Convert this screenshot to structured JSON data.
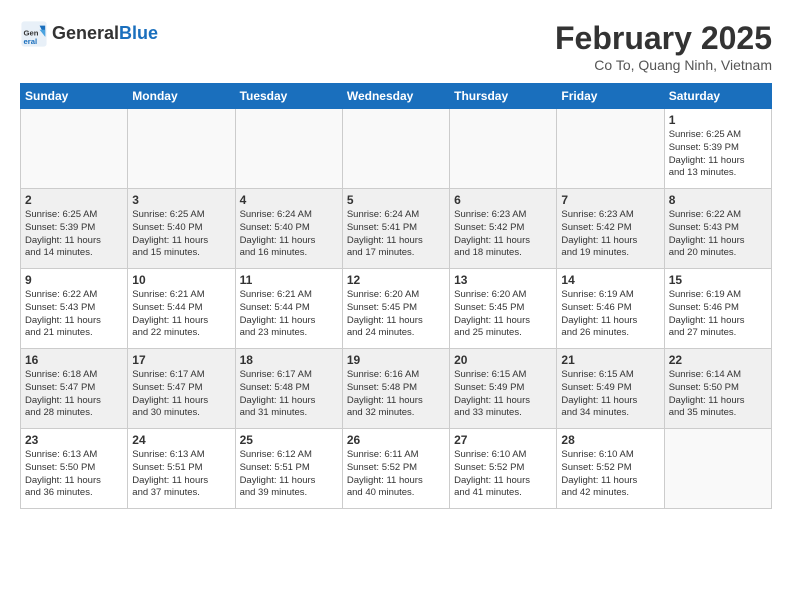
{
  "header": {
    "logo_general": "General",
    "logo_blue": "Blue",
    "title": "February 2025",
    "subtitle": "Co To, Quang Ninh, Vietnam"
  },
  "days_of_week": [
    "Sunday",
    "Monday",
    "Tuesday",
    "Wednesday",
    "Thursday",
    "Friday",
    "Saturday"
  ],
  "weeks": [
    [
      {
        "day": "",
        "info": ""
      },
      {
        "day": "",
        "info": ""
      },
      {
        "day": "",
        "info": ""
      },
      {
        "day": "",
        "info": ""
      },
      {
        "day": "",
        "info": ""
      },
      {
        "day": "",
        "info": ""
      },
      {
        "day": "1",
        "info": "Sunrise: 6:25 AM\nSunset: 5:39 PM\nDaylight: 11 hours\nand 13 minutes."
      }
    ],
    [
      {
        "day": "2",
        "info": "Sunrise: 6:25 AM\nSunset: 5:39 PM\nDaylight: 11 hours\nand 14 minutes."
      },
      {
        "day": "3",
        "info": "Sunrise: 6:25 AM\nSunset: 5:40 PM\nDaylight: 11 hours\nand 15 minutes."
      },
      {
        "day": "4",
        "info": "Sunrise: 6:24 AM\nSunset: 5:40 PM\nDaylight: 11 hours\nand 16 minutes."
      },
      {
        "day": "5",
        "info": "Sunrise: 6:24 AM\nSunset: 5:41 PM\nDaylight: 11 hours\nand 17 minutes."
      },
      {
        "day": "6",
        "info": "Sunrise: 6:23 AM\nSunset: 5:42 PM\nDaylight: 11 hours\nand 18 minutes."
      },
      {
        "day": "7",
        "info": "Sunrise: 6:23 AM\nSunset: 5:42 PM\nDaylight: 11 hours\nand 19 minutes."
      },
      {
        "day": "8",
        "info": "Sunrise: 6:22 AM\nSunset: 5:43 PM\nDaylight: 11 hours\nand 20 minutes."
      }
    ],
    [
      {
        "day": "9",
        "info": "Sunrise: 6:22 AM\nSunset: 5:43 PM\nDaylight: 11 hours\nand 21 minutes."
      },
      {
        "day": "10",
        "info": "Sunrise: 6:21 AM\nSunset: 5:44 PM\nDaylight: 11 hours\nand 22 minutes."
      },
      {
        "day": "11",
        "info": "Sunrise: 6:21 AM\nSunset: 5:44 PM\nDaylight: 11 hours\nand 23 minutes."
      },
      {
        "day": "12",
        "info": "Sunrise: 6:20 AM\nSunset: 5:45 PM\nDaylight: 11 hours\nand 24 minutes."
      },
      {
        "day": "13",
        "info": "Sunrise: 6:20 AM\nSunset: 5:45 PM\nDaylight: 11 hours\nand 25 minutes."
      },
      {
        "day": "14",
        "info": "Sunrise: 6:19 AM\nSunset: 5:46 PM\nDaylight: 11 hours\nand 26 minutes."
      },
      {
        "day": "15",
        "info": "Sunrise: 6:19 AM\nSunset: 5:46 PM\nDaylight: 11 hours\nand 27 minutes."
      }
    ],
    [
      {
        "day": "16",
        "info": "Sunrise: 6:18 AM\nSunset: 5:47 PM\nDaylight: 11 hours\nand 28 minutes."
      },
      {
        "day": "17",
        "info": "Sunrise: 6:17 AM\nSunset: 5:47 PM\nDaylight: 11 hours\nand 30 minutes."
      },
      {
        "day": "18",
        "info": "Sunrise: 6:17 AM\nSunset: 5:48 PM\nDaylight: 11 hours\nand 31 minutes."
      },
      {
        "day": "19",
        "info": "Sunrise: 6:16 AM\nSunset: 5:48 PM\nDaylight: 11 hours\nand 32 minutes."
      },
      {
        "day": "20",
        "info": "Sunrise: 6:15 AM\nSunset: 5:49 PM\nDaylight: 11 hours\nand 33 minutes."
      },
      {
        "day": "21",
        "info": "Sunrise: 6:15 AM\nSunset: 5:49 PM\nDaylight: 11 hours\nand 34 minutes."
      },
      {
        "day": "22",
        "info": "Sunrise: 6:14 AM\nSunset: 5:50 PM\nDaylight: 11 hours\nand 35 minutes."
      }
    ],
    [
      {
        "day": "23",
        "info": "Sunrise: 6:13 AM\nSunset: 5:50 PM\nDaylight: 11 hours\nand 36 minutes."
      },
      {
        "day": "24",
        "info": "Sunrise: 6:13 AM\nSunset: 5:51 PM\nDaylight: 11 hours\nand 37 minutes."
      },
      {
        "day": "25",
        "info": "Sunrise: 6:12 AM\nSunset: 5:51 PM\nDaylight: 11 hours\nand 39 minutes."
      },
      {
        "day": "26",
        "info": "Sunrise: 6:11 AM\nSunset: 5:52 PM\nDaylight: 11 hours\nand 40 minutes."
      },
      {
        "day": "27",
        "info": "Sunrise: 6:10 AM\nSunset: 5:52 PM\nDaylight: 11 hours\nand 41 minutes."
      },
      {
        "day": "28",
        "info": "Sunrise: 6:10 AM\nSunset: 5:52 PM\nDaylight: 11 hours\nand 42 minutes."
      },
      {
        "day": "",
        "info": ""
      }
    ]
  ]
}
